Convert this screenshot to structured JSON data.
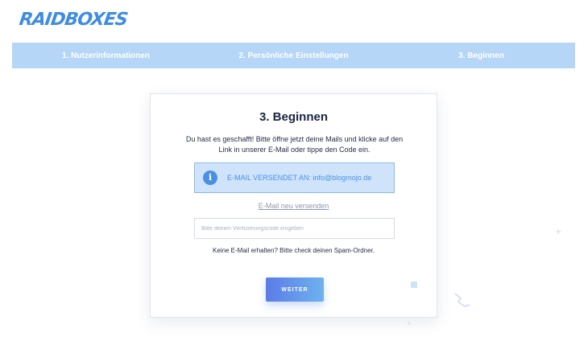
{
  "brand": {
    "logo_text": "RAIDBOXES"
  },
  "steps": [
    {
      "label": "1. Nutzerinformationen"
    },
    {
      "label": "2. Persönliche Einstellungen"
    },
    {
      "label": "3. Beginnen"
    }
  ],
  "card": {
    "title": "3. Beginnen",
    "instructions": "Du hast es geschafft! Bitte öffne jetzt deine Mails und klicke auf den Link in unserer E-Mail oder tippe den Code ein.",
    "info_text": "E-MAIL VERSENDET AN: info@blogmojo.de",
    "info_icon_glyph": "i",
    "resend_link": "E-Mail neu versenden",
    "code_placeholder": "Bitte deinen Verifizierungscode eingeben",
    "code_value": "",
    "spam_hint": "Keine E-Mail erhalten? Bitte check deinen Spam-Ordner.",
    "submit_label": "WEITER"
  },
  "colors": {
    "accent": "#4a90e2",
    "stepbar": "#b6d6f7",
    "infobox": "#cfe4fb"
  }
}
